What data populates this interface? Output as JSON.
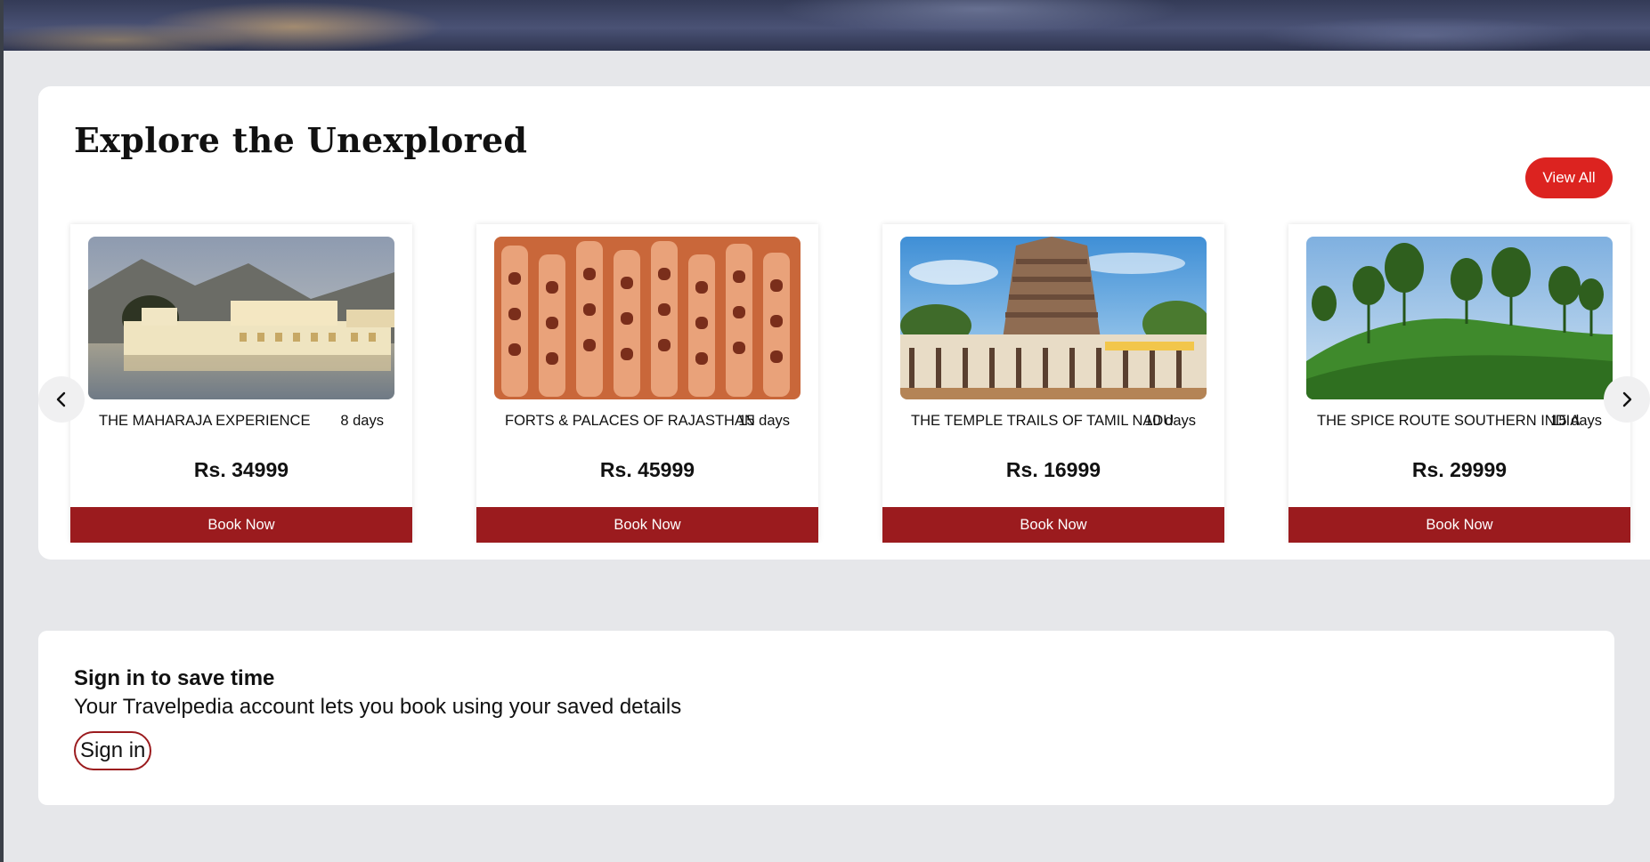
{
  "section": {
    "title": "Explore the Unexplored",
    "view_all_label": "View All"
  },
  "tours": [
    {
      "name": "THE MAHARAJA EXPERIENCE",
      "duration": "8 days",
      "price": "Rs. 34999",
      "book_label": "Book Now",
      "image": "lake-palace-photo"
    },
    {
      "name": "FORTS & PALACES OF RAJASTHAN",
      "duration": "15 days",
      "price": "Rs. 45999",
      "book_label": "Book Now",
      "image": "hawa-mahal-photo"
    },
    {
      "name": "THE TEMPLE TRAILS OF TAMIL NADU",
      "duration": "10 days",
      "price": "Rs. 16999",
      "book_label": "Book Now",
      "image": "temple-gopuram-photo"
    },
    {
      "name": "THE SPICE ROUTE SOUTHERN INDIA",
      "duration": "15 days",
      "price": "Rs. 29999",
      "book_label": "Book Now",
      "image": "tea-plantation-photo"
    }
  ],
  "carousel": {
    "prev_icon": "chevron-left-icon",
    "next_icon": "chevron-right-icon"
  },
  "signin": {
    "title": "Sign in to save time",
    "description": "Your Travelpedia account lets you book using your saved details",
    "button_label": "Sign in"
  },
  "colors": {
    "page_bg": "#e6e7ea",
    "accent_red": "#dc2320",
    "book_red": "#9b1b1e"
  }
}
